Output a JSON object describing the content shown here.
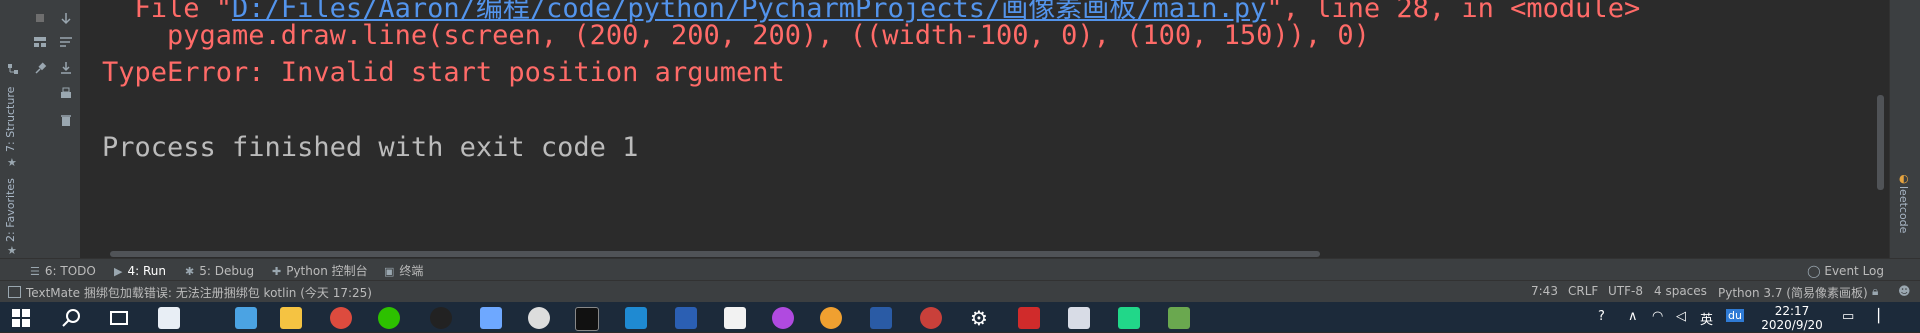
{
  "left_strip": {
    "structure_label": "7: Structure",
    "favorites_label": "2: Favorites"
  },
  "console": {
    "line0": "  File \"D:/Files/Aaron/编程/code/python/PycharmProjects/画像素画板/main.py\", line 28, in <module>",
    "line0_prefix": "  File \"",
    "line0_link": "D:/Files/Aaron/编程/code/python/PycharmProjects/画像素画板/main.py",
    "line0_suffix": "\", line 28, in <module>",
    "line1": "    pygame.draw.line(screen, (200, 200, 200), ((width-100, 0), (100, 150)), 0)",
    "line2": "TypeError: Invalid start position argument",
    "line3": "",
    "line4": "Process finished with exit code 1"
  },
  "right_strip": {
    "leetcode_label": "leetcode"
  },
  "toolbar": {
    "tabs": [
      {
        "label": "6: TODO",
        "icon": "list-icon"
      },
      {
        "label": "4: Run",
        "icon": "play-icon"
      },
      {
        "label": "5: Debug",
        "icon": "bug-icon"
      },
      {
        "label": "Python 控制台",
        "icon": "python-console-icon"
      },
      {
        "label": "终端",
        "icon": "terminal-icon"
      }
    ],
    "event_log": "Event Log"
  },
  "status": {
    "message": "TextMate 捆绑包加载错误: 无法注册捆绑包 kotlin (今天 17:25)",
    "position": "7:43",
    "line_sep": "CRLF",
    "encoding": "UTF-8",
    "indent": "4 spaces",
    "interpreter": "Python 3.7 (简易像素画板)"
  },
  "taskbar": {
    "time": "22:17",
    "date": "2020/9/20",
    "ime": "英",
    "ime_badge": "du"
  },
  "colors": {
    "error": "#ff6b68",
    "link": "#5394ec",
    "text": "#bbbbbb",
    "background": "#2b2b2b",
    "panel": "#3c3f41"
  }
}
